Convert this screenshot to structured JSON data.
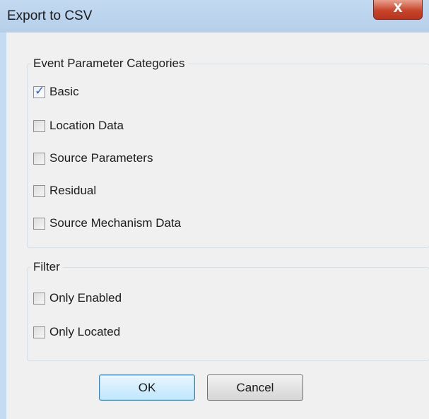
{
  "window": {
    "title": "Export to CSV",
    "close_glyph": "X"
  },
  "categories": {
    "legend": "Event Parameter Categories",
    "options": [
      {
        "label": "Basic",
        "checked": true
      },
      {
        "label": "Location Data",
        "checked": false
      },
      {
        "label": "Source Parameters",
        "checked": false
      },
      {
        "label": "Residual",
        "checked": false
      },
      {
        "label": "Source Mechanism Data",
        "checked": false
      }
    ]
  },
  "filter": {
    "legend": "Filter",
    "options": [
      {
        "label": "Only Enabled",
        "checked": false
      },
      {
        "label": "Only Located",
        "checked": false
      }
    ]
  },
  "buttons": {
    "ok": "OK",
    "cancel": "Cancel"
  },
  "icons": {
    "checkmark": "check-icon",
    "close": "close-icon"
  },
  "colors": {
    "titlebar": "#c2d9f1",
    "close_button": "#c7452b",
    "ok_border": "#3c7fb1",
    "check": "#3b5fb2"
  }
}
